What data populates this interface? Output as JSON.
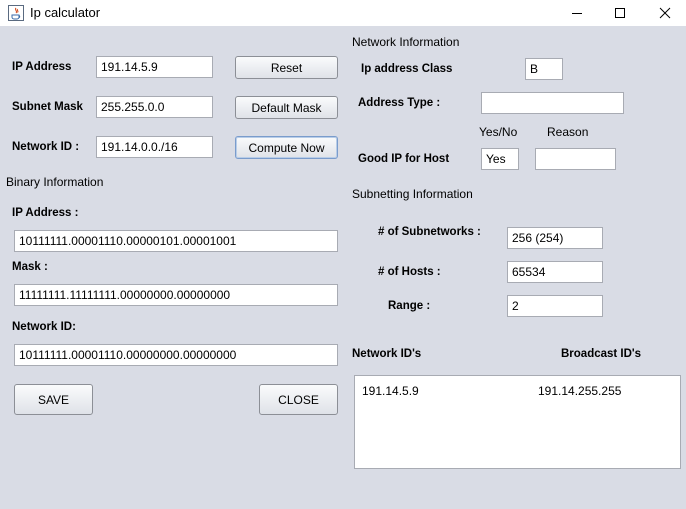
{
  "window": {
    "title": "Ip calculator"
  },
  "left": {
    "ip_address_label": "IP Address",
    "ip_address_value": "191.14.5.9",
    "subnet_mask_label": "Subnet Mask",
    "subnet_mask_value": "255.255.0.0",
    "network_id_label": "Network ID :",
    "network_id_value": "191.14.0.0./16",
    "reset_label": "Reset",
    "default_mask_label": "Default Mask",
    "compute_label": "Compute Now"
  },
  "binary": {
    "section_label": "Binary Information",
    "ip_label": "IP Address :",
    "ip_value": "10111111.00001110.00000101.00001001",
    "mask_label": "Mask :",
    "mask_value": "11111111.11111111.00000000.00000000",
    "netid_label": "Network ID:",
    "netid_value": "10111111.00001110.00000000.00000000"
  },
  "buttons": {
    "save_label": "SAVE",
    "close_label": "CLOSE"
  },
  "network_info": {
    "section_label": "Network Information",
    "class_label": "Ip address Class",
    "class_value": "B",
    "type_label": "Address Type :",
    "type_value": "",
    "yesno_header": "Yes/No",
    "reason_header": "Reason",
    "good_ip_label": "Good IP for Host",
    "good_ip_value": "Yes",
    "reason_value": ""
  },
  "subnetting": {
    "section_label": "Subnetting Information",
    "subnets_label": "# of Subnetworks :",
    "subnets_value": "256 (254)",
    "hosts_label": "# of Hosts :",
    "hosts_value": "65534",
    "range_label": "Range :",
    "range_value": "2"
  },
  "ids": {
    "network_header": "Network ID's",
    "broadcast_header": "Broadcast ID's",
    "rows": [
      {
        "network": "191.14.5.9",
        "broadcast": "191.14.255.255"
      }
    ]
  }
}
